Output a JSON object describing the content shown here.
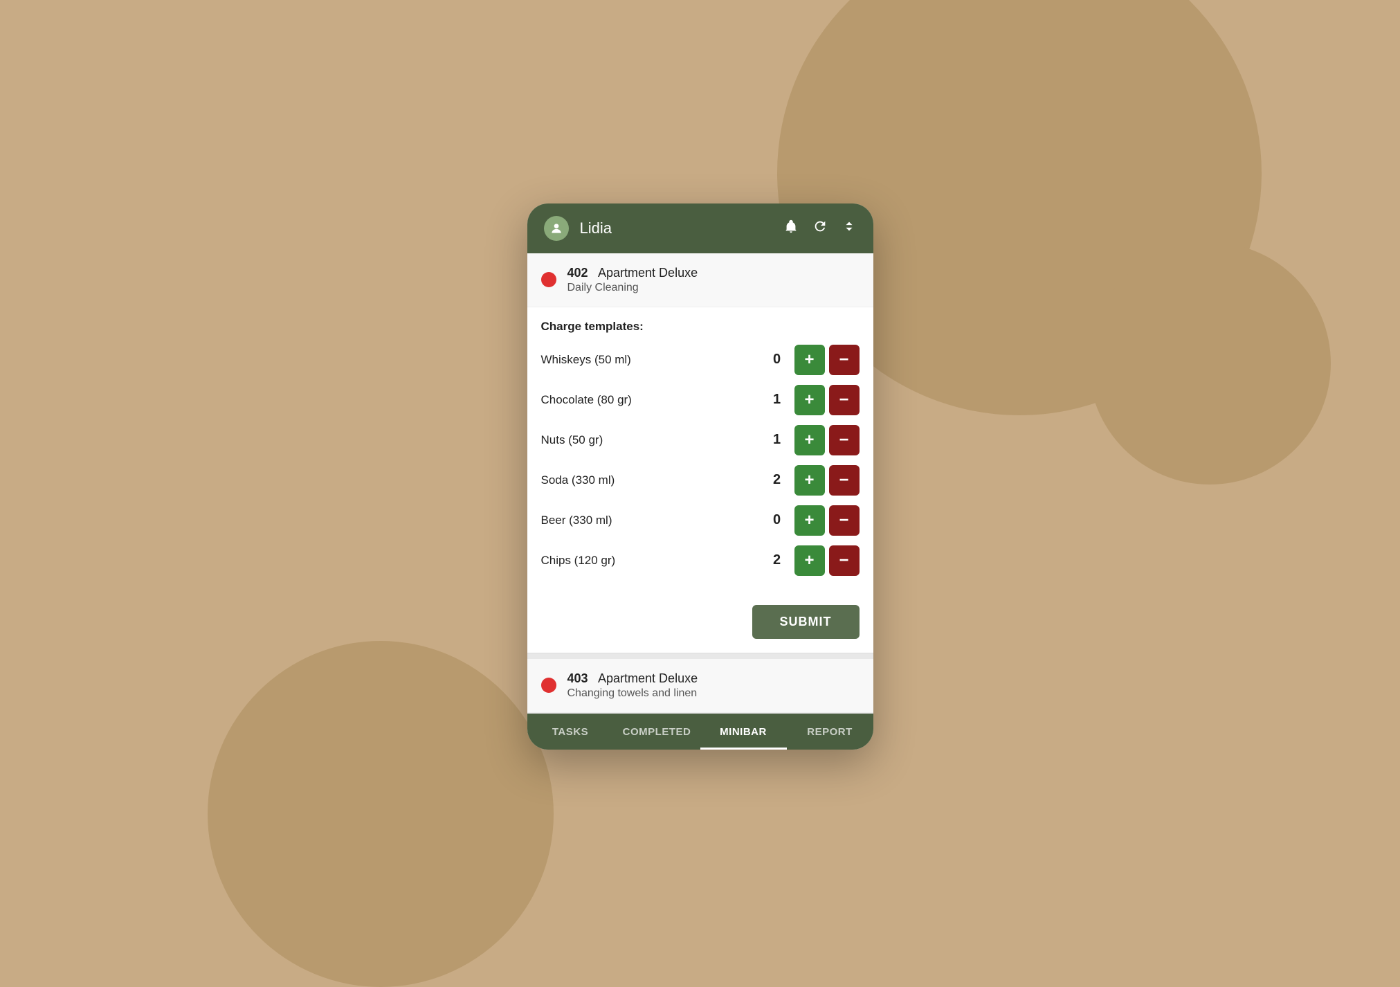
{
  "header": {
    "username": "Lidia",
    "avatar_icon": "person-icon",
    "bell_icon": "bell-icon",
    "refresh_icon": "refresh-icon",
    "expand_icon": "expand-icon"
  },
  "tasks": [
    {
      "id": "task-402",
      "status_color": "#e03030",
      "number": "402",
      "room_type": "Apartment Deluxe",
      "task_type": "Daily Cleaning",
      "charge_templates_label": "Charge templates:",
      "items": [
        {
          "name": "Whiskeys (50 ml)",
          "qty": "0"
        },
        {
          "name": "Chocolate (80 gr)",
          "qty": "1"
        },
        {
          "name": "Nuts (50 gr)",
          "qty": "1"
        },
        {
          "name": "Soda (330 ml)",
          "qty": "2"
        },
        {
          "name": "Beer (330 ml)",
          "qty": "0"
        },
        {
          "name": "Chips (120 gr)",
          "qty": "2"
        }
      ],
      "submit_label": "SUBMIT"
    },
    {
      "id": "task-403",
      "status_color": "#e03030",
      "number": "403",
      "room_type": "Apartment Deluxe",
      "task_type": "Changing towels and linen",
      "charge_templates_label": null,
      "items": [],
      "submit_label": null
    }
  ],
  "bottom_nav": {
    "items": [
      {
        "id": "tasks",
        "label": "TASKS",
        "active": false
      },
      {
        "id": "completed",
        "label": "COMPLETED",
        "active": false
      },
      {
        "id": "minibar",
        "label": "MINIBAR",
        "active": true
      },
      {
        "id": "report",
        "label": "REPORT",
        "active": false
      }
    ]
  },
  "buttons": {
    "plus": "+",
    "minus": "−"
  }
}
